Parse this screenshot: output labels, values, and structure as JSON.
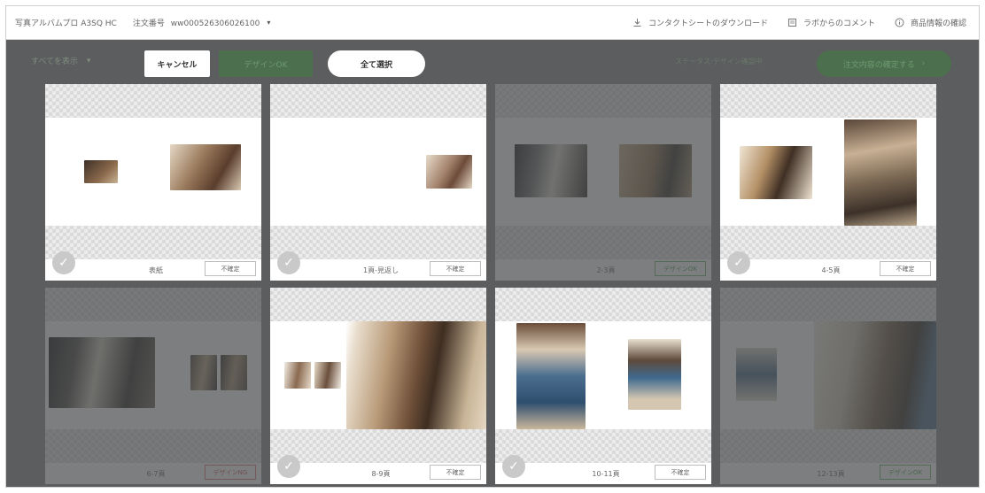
{
  "header": {
    "product": "写真アルバムプロ A3SQ HC",
    "order_label": "注文番号",
    "order_number": "ww000526306026100",
    "caret": "▾",
    "links": [
      {
        "label": "コンタクトシートのダウンロード",
        "icon": "download-icon"
      },
      {
        "label": "ラボからのコメント",
        "icon": "comment-icon"
      },
      {
        "label": "商品情報の確認",
        "icon": "info-icon"
      }
    ]
  },
  "toolbar": {
    "filter_label": "すべてを表示",
    "filter_caret": "▾",
    "cancel_label": "キャンセル",
    "design_ok_label": "デザインOK",
    "select_all_label": "全て選択",
    "status_text": "ステータス:デザイン確認中",
    "order_button_label": "注文内容の確定する",
    "order_button_arrow": "›"
  },
  "cards": [
    {
      "page": "表紙",
      "status": "不確定",
      "status_type": "none",
      "dim": false,
      "checkable": true
    },
    {
      "page": "1頁-見返し",
      "status": "不確定",
      "status_type": "none",
      "dim": false,
      "checkable": true
    },
    {
      "page": "2-3頁",
      "status": "デザインOK",
      "status_type": "ok",
      "dim": true,
      "checkable": false
    },
    {
      "page": "4-5頁",
      "status": "不確定",
      "status_type": "none",
      "dim": false,
      "checkable": true
    },
    {
      "page": "6-7頁",
      "status": "デザインNG",
      "status_type": "ng",
      "dim": true,
      "checkable": false
    },
    {
      "page": "8-9頁",
      "status": "不確定",
      "status_type": "none",
      "dim": false,
      "checkable": true
    },
    {
      "page": "10-11頁",
      "status": "不確定",
      "status_type": "none",
      "dim": false,
      "checkable": true
    },
    {
      "page": "12-13頁",
      "status": "デザインOK",
      "status_type": "ok",
      "dim": true,
      "checkable": false
    }
  ],
  "colors": {
    "background": "#5b5d5e",
    "accent_green": "#4c6f4d",
    "ok_green": "#4fa550",
    "ng_red": "#d55a5a"
  }
}
